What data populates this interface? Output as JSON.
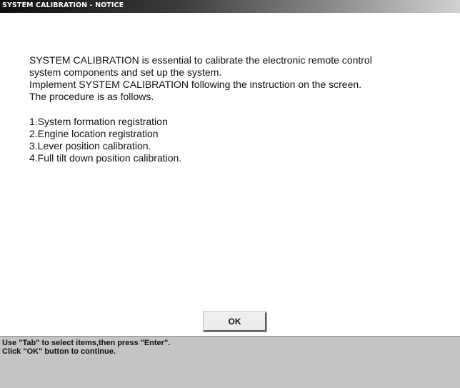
{
  "window": {
    "title": "SYSTEM CALIBRATION - NOTICE"
  },
  "notice": {
    "intro_lines": [
      "SYSTEM CALIBRATION is essential to calibrate the electronic remote control",
      "system components and set up the system.",
      "Implement SYSTEM CALIBRATION following the instruction on the screen.",
      "The procedure is as follows."
    ],
    "steps": [
      "1.System formation registration",
      "2.Engine location registration",
      "3.Lever position calibration.",
      "4.Full tilt down position calibration."
    ]
  },
  "buttons": {
    "ok_label": "OK"
  },
  "status": {
    "lines": [
      "Use \"Tab\" to select items,then press \"Enter\".",
      "Click \"OK\" button to continue."
    ]
  }
}
